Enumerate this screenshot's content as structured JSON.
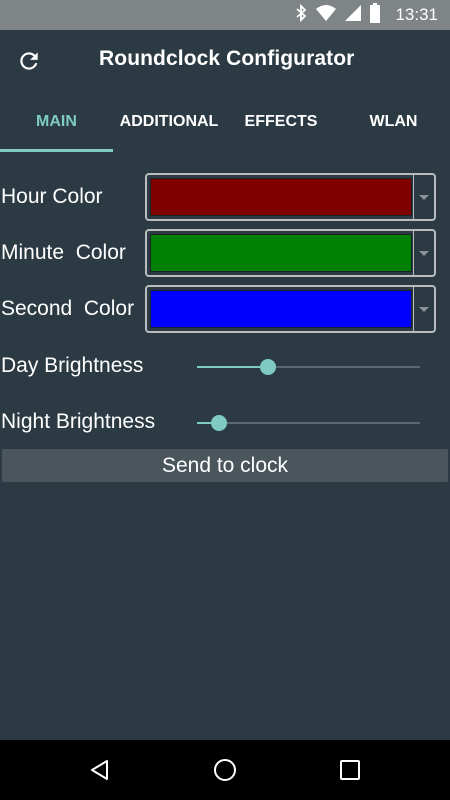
{
  "status_bar": {
    "time": "13:31",
    "icons": [
      "bluetooth-icon",
      "wifi-icon",
      "signal-icon",
      "battery-icon"
    ]
  },
  "toolbar": {
    "title": "Roundclock Configurator",
    "refresh_icon": "refresh-icon"
  },
  "tabs": [
    {
      "label": "MAIN",
      "active": true
    },
    {
      "label": "ADDITIONAL",
      "active": false
    },
    {
      "label": "EFFECTS",
      "active": false
    },
    {
      "label": "WLAN",
      "active": false
    }
  ],
  "colors": {
    "accent": "#7fcbc3",
    "background": "#2c3a43"
  },
  "main": {
    "hour_color": {
      "label": "Hour Color",
      "value": "#7f0000"
    },
    "minute_color": {
      "label": "Minute  Color",
      "value": "#008000"
    },
    "second_color": {
      "label": "Second  Color",
      "value": "#0000ff"
    },
    "day_brightness": {
      "label": "Day Brightness",
      "fraction": 0.32
    },
    "night_brightness": {
      "label": "Night Brightness",
      "fraction": 0.1
    },
    "send_button": "Send to clock"
  },
  "nav_bar": {
    "back_icon": "back-triangle-icon",
    "home_icon": "home-circle-icon",
    "recents_icon": "recents-square-icon"
  }
}
